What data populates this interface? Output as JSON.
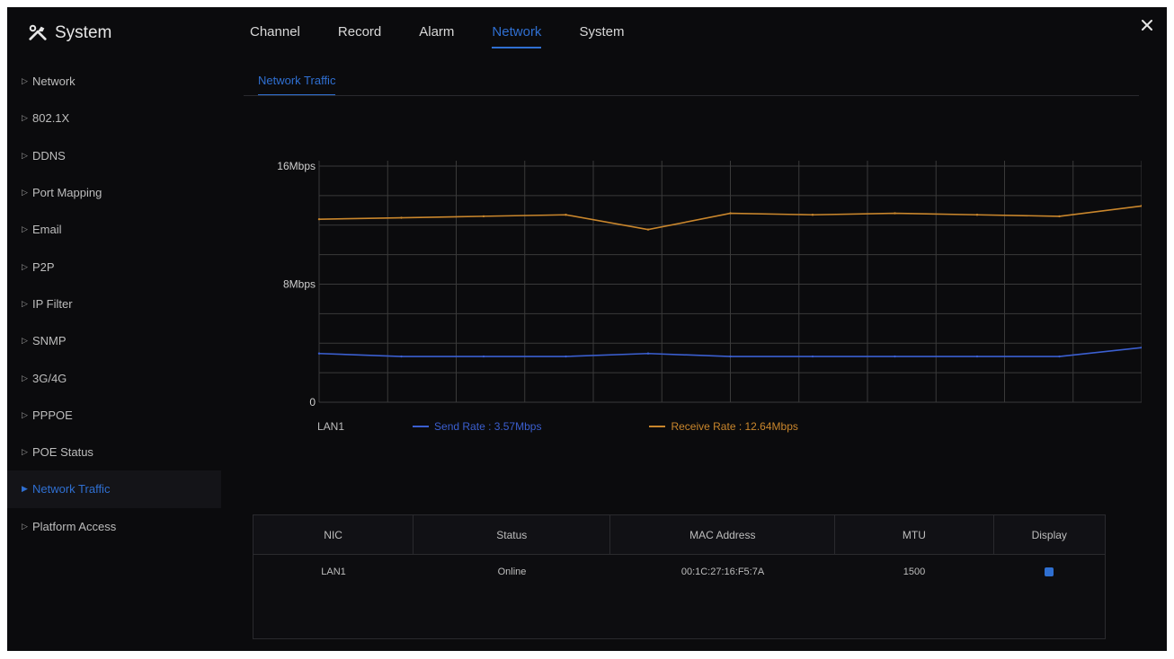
{
  "header": {
    "title": "System",
    "title_icon": "tools-icon",
    "tabs": [
      {
        "label": "Channel",
        "active": false
      },
      {
        "label": "Record",
        "active": false
      },
      {
        "label": "Alarm",
        "active": false
      },
      {
        "label": "Network",
        "active": true
      },
      {
        "label": "System",
        "active": false
      }
    ],
    "close_icon": "close-icon"
  },
  "sidebar": {
    "items": [
      {
        "label": "Network",
        "active": false
      },
      {
        "label": "802.1X",
        "active": false
      },
      {
        "label": "DDNS",
        "active": false
      },
      {
        "label": "Port Mapping",
        "active": false
      },
      {
        "label": "Email",
        "active": false
      },
      {
        "label": "P2P",
        "active": false
      },
      {
        "label": "IP Filter",
        "active": false
      },
      {
        "label": "SNMP",
        "active": false
      },
      {
        "label": "3G/4G",
        "active": false
      },
      {
        "label": "PPPOE",
        "active": false
      },
      {
        "label": "POE Status",
        "active": false
      },
      {
        "label": "Network Traffic",
        "active": true
      },
      {
        "label": "Platform Access",
        "active": false
      }
    ]
  },
  "subtab": {
    "label": "Network Traffic"
  },
  "chart_data": {
    "type": "line",
    "y_ticks": [
      "16Mbps",
      "8Mbps",
      "0"
    ],
    "ylim": [
      0,
      16
    ],
    "grid": true,
    "x": [
      0,
      1,
      2,
      3,
      4,
      5,
      6,
      7,
      8,
      9,
      10
    ],
    "series": [
      {
        "name": "Send Rate",
        "color": "#3b5fd0",
        "values": [
          3.3,
          3.1,
          3.1,
          3.1,
          3.3,
          3.1,
          3.1,
          3.1,
          3.1,
          3.1,
          3.7
        ]
      },
      {
        "name": "Receive Rate",
        "color": "#c9862c",
        "values": [
          12.4,
          12.5,
          12.6,
          12.7,
          11.7,
          12.8,
          12.7,
          12.8,
          12.7,
          12.6,
          13.3
        ]
      }
    ]
  },
  "legend": {
    "interface": "LAN1",
    "send": {
      "label": "Send Rate : 3.57Mbps",
      "color": "#3b5fd0"
    },
    "receive": {
      "label": "Receive Rate : 12.64Mbps",
      "color": "#c9862c"
    }
  },
  "table": {
    "headers": [
      "NIC",
      "Status",
      "MAC Address",
      "MTU",
      "Display"
    ],
    "rows": [
      {
        "nic": "LAN1",
        "status": "Online",
        "mac": "00:1C:27:16:F5:7A",
        "mtu": "1500",
        "display": true
      }
    ]
  },
  "colors": {
    "accent": "#2f6fd1",
    "background": "#0b0b0d",
    "grid": "#3a3a3a"
  }
}
